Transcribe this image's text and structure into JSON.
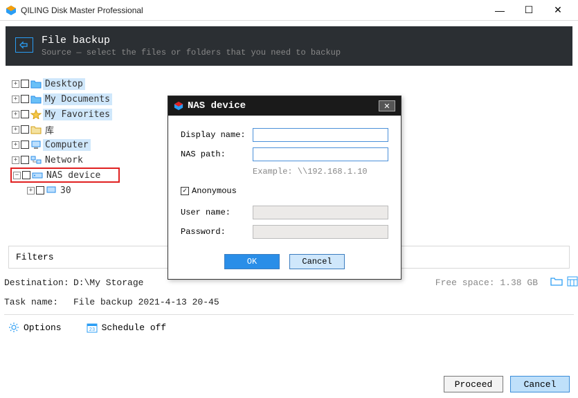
{
  "window": {
    "title": "QILING Disk Master Professional"
  },
  "header": {
    "title": "File backup",
    "subtitle": "Source — select the files or folders that you need to backup"
  },
  "tree": {
    "items": [
      {
        "label": "Desktop",
        "hl": true
      },
      {
        "label": "My Documents",
        "hl": true
      },
      {
        "label": "My Favorites",
        "hl": true
      },
      {
        "label": "库",
        "hl": false
      },
      {
        "label": "Computer",
        "hl": true
      },
      {
        "label": "Network",
        "hl": false
      },
      {
        "label": "NAS device",
        "hl": false,
        "selected": true
      },
      {
        "label": "30",
        "hl": false,
        "child": true
      }
    ]
  },
  "filters_label": "Filters",
  "destination": {
    "label": "Destination:",
    "value": "D:\\My Storage",
    "free": "Free space: 1.38 GB"
  },
  "taskname": {
    "label": "Task name:",
    "value": "File backup 2021-4-13 20-45"
  },
  "options_label": "Options",
  "schedule_label": "Schedule off",
  "footer": {
    "proceed": "Proceed",
    "cancel": "Cancel"
  },
  "dialog": {
    "title": "NAS device",
    "display_name_label": "Display name:",
    "display_name_value": "",
    "nas_path_label": "NAS path:",
    "nas_path_value": "",
    "example": "Example: \\\\192.168.1.10",
    "anonymous_label": "Anonymous",
    "anonymous_checked": true,
    "username_label": "User name:",
    "username_value": "",
    "password_label": "Password:",
    "password_value": "",
    "ok": "OK",
    "cancel": "Cancel"
  }
}
